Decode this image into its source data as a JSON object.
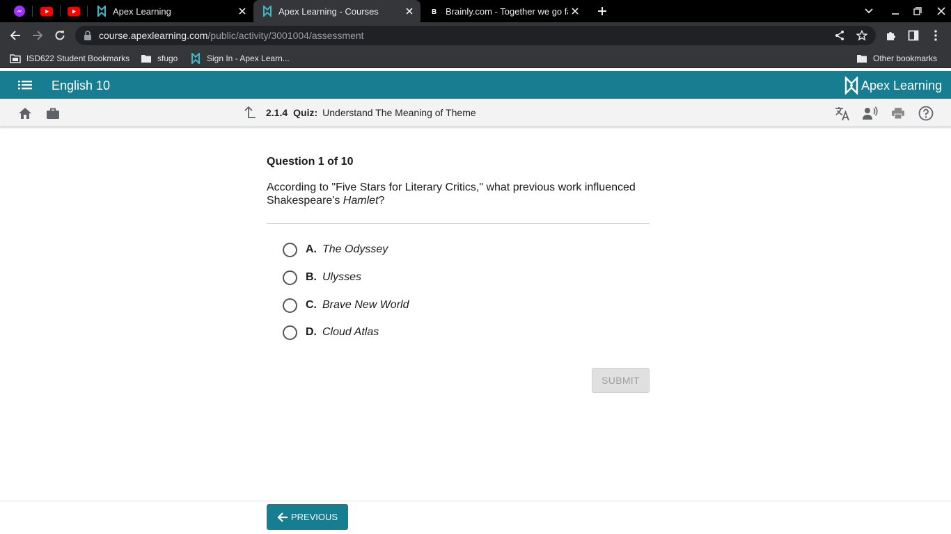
{
  "browser": {
    "tabs": [
      {
        "title": "Apex Learning",
        "active": false
      },
      {
        "title": "Apex Learning - Courses",
        "active": true
      },
      {
        "title": "Brainly.com - Together we go far",
        "active": false
      }
    ],
    "address": {
      "host": "course.apexlearning.com",
      "path": "/public/activity/3001004/assessment"
    },
    "bookmarks": [
      {
        "label": "ISD622 Student Bookmarks",
        "icon": "bookmark-folder-icon"
      },
      {
        "label": "sfugo",
        "icon": "folder-icon"
      },
      {
        "label": "Sign In - Apex Learn...",
        "icon": "apex-favicon"
      }
    ],
    "other_bookmarks": "Other bookmarks"
  },
  "app": {
    "course_title": "English 10",
    "logo_text": "Apex Learning",
    "breadcrumb": {
      "number": "2.1.4",
      "kind": "Quiz:",
      "title": "Understand The Meaning of Theme"
    }
  },
  "question": {
    "heading": "Question 1 of 10",
    "text_before": "According to \"Five Stars for Literary Critics,\" what previous work influenced Shakespeare's ",
    "text_italic": "Hamlet",
    "text_after": "?",
    "options": [
      {
        "letter": "A.",
        "text": "The Odyssey"
      },
      {
        "letter": "B.",
        "text": "Ulysses"
      },
      {
        "letter": "C.",
        "text": "Brave New World"
      },
      {
        "letter": "D.",
        "text": "Cloud Atlas"
      }
    ],
    "submit_label": "SUBMIT"
  },
  "footer": {
    "previous_label": "PREVIOUS"
  },
  "colors": {
    "brand_teal": "#177d91",
    "browser_dark": "#35363a"
  }
}
